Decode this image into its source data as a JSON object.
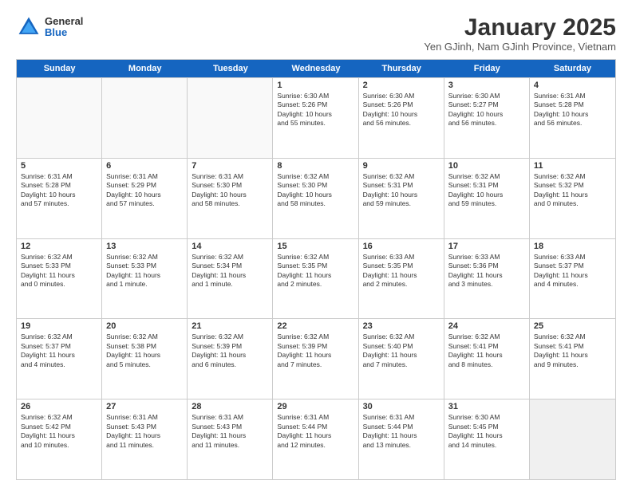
{
  "logo": {
    "general": "General",
    "blue": "Blue"
  },
  "title": "January 2025",
  "subtitle": "Yen GJinh, Nam GJinh Province, Vietnam",
  "days": [
    "Sunday",
    "Monday",
    "Tuesday",
    "Wednesday",
    "Thursday",
    "Friday",
    "Saturday"
  ],
  "rows": [
    [
      {
        "day": "",
        "lines": []
      },
      {
        "day": "",
        "lines": []
      },
      {
        "day": "",
        "lines": []
      },
      {
        "day": "1",
        "lines": [
          "Sunrise: 6:30 AM",
          "Sunset: 5:26 PM",
          "Daylight: 10 hours",
          "and 55 minutes."
        ]
      },
      {
        "day": "2",
        "lines": [
          "Sunrise: 6:30 AM",
          "Sunset: 5:26 PM",
          "Daylight: 10 hours",
          "and 56 minutes."
        ]
      },
      {
        "day": "3",
        "lines": [
          "Sunrise: 6:30 AM",
          "Sunset: 5:27 PM",
          "Daylight: 10 hours",
          "and 56 minutes."
        ]
      },
      {
        "day": "4",
        "lines": [
          "Sunrise: 6:31 AM",
          "Sunset: 5:28 PM",
          "Daylight: 10 hours",
          "and 56 minutes."
        ]
      }
    ],
    [
      {
        "day": "5",
        "lines": [
          "Sunrise: 6:31 AM",
          "Sunset: 5:28 PM",
          "Daylight: 10 hours",
          "and 57 minutes."
        ]
      },
      {
        "day": "6",
        "lines": [
          "Sunrise: 6:31 AM",
          "Sunset: 5:29 PM",
          "Daylight: 10 hours",
          "and 57 minutes."
        ]
      },
      {
        "day": "7",
        "lines": [
          "Sunrise: 6:31 AM",
          "Sunset: 5:30 PM",
          "Daylight: 10 hours",
          "and 58 minutes."
        ]
      },
      {
        "day": "8",
        "lines": [
          "Sunrise: 6:32 AM",
          "Sunset: 5:30 PM",
          "Daylight: 10 hours",
          "and 58 minutes."
        ]
      },
      {
        "day": "9",
        "lines": [
          "Sunrise: 6:32 AM",
          "Sunset: 5:31 PM",
          "Daylight: 10 hours",
          "and 59 minutes."
        ]
      },
      {
        "day": "10",
        "lines": [
          "Sunrise: 6:32 AM",
          "Sunset: 5:31 PM",
          "Daylight: 10 hours",
          "and 59 minutes."
        ]
      },
      {
        "day": "11",
        "lines": [
          "Sunrise: 6:32 AM",
          "Sunset: 5:32 PM",
          "Daylight: 11 hours",
          "and 0 minutes."
        ]
      }
    ],
    [
      {
        "day": "12",
        "lines": [
          "Sunrise: 6:32 AM",
          "Sunset: 5:33 PM",
          "Daylight: 11 hours",
          "and 0 minutes."
        ]
      },
      {
        "day": "13",
        "lines": [
          "Sunrise: 6:32 AM",
          "Sunset: 5:33 PM",
          "Daylight: 11 hours",
          "and 1 minute."
        ]
      },
      {
        "day": "14",
        "lines": [
          "Sunrise: 6:32 AM",
          "Sunset: 5:34 PM",
          "Daylight: 11 hours",
          "and 1 minute."
        ]
      },
      {
        "day": "15",
        "lines": [
          "Sunrise: 6:32 AM",
          "Sunset: 5:35 PM",
          "Daylight: 11 hours",
          "and 2 minutes."
        ]
      },
      {
        "day": "16",
        "lines": [
          "Sunrise: 6:33 AM",
          "Sunset: 5:35 PM",
          "Daylight: 11 hours",
          "and 2 minutes."
        ]
      },
      {
        "day": "17",
        "lines": [
          "Sunrise: 6:33 AM",
          "Sunset: 5:36 PM",
          "Daylight: 11 hours",
          "and 3 minutes."
        ]
      },
      {
        "day": "18",
        "lines": [
          "Sunrise: 6:33 AM",
          "Sunset: 5:37 PM",
          "Daylight: 11 hours",
          "and 4 minutes."
        ]
      }
    ],
    [
      {
        "day": "19",
        "lines": [
          "Sunrise: 6:32 AM",
          "Sunset: 5:37 PM",
          "Daylight: 11 hours",
          "and 4 minutes."
        ]
      },
      {
        "day": "20",
        "lines": [
          "Sunrise: 6:32 AM",
          "Sunset: 5:38 PM",
          "Daylight: 11 hours",
          "and 5 minutes."
        ]
      },
      {
        "day": "21",
        "lines": [
          "Sunrise: 6:32 AM",
          "Sunset: 5:39 PM",
          "Daylight: 11 hours",
          "and 6 minutes."
        ]
      },
      {
        "day": "22",
        "lines": [
          "Sunrise: 6:32 AM",
          "Sunset: 5:39 PM",
          "Daylight: 11 hours",
          "and 7 minutes."
        ]
      },
      {
        "day": "23",
        "lines": [
          "Sunrise: 6:32 AM",
          "Sunset: 5:40 PM",
          "Daylight: 11 hours",
          "and 7 minutes."
        ]
      },
      {
        "day": "24",
        "lines": [
          "Sunrise: 6:32 AM",
          "Sunset: 5:41 PM",
          "Daylight: 11 hours",
          "and 8 minutes."
        ]
      },
      {
        "day": "25",
        "lines": [
          "Sunrise: 6:32 AM",
          "Sunset: 5:41 PM",
          "Daylight: 11 hours",
          "and 9 minutes."
        ]
      }
    ],
    [
      {
        "day": "26",
        "lines": [
          "Sunrise: 6:32 AM",
          "Sunset: 5:42 PM",
          "Daylight: 11 hours",
          "and 10 minutes."
        ]
      },
      {
        "day": "27",
        "lines": [
          "Sunrise: 6:31 AM",
          "Sunset: 5:43 PM",
          "Daylight: 11 hours",
          "and 11 minutes."
        ]
      },
      {
        "day": "28",
        "lines": [
          "Sunrise: 6:31 AM",
          "Sunset: 5:43 PM",
          "Daylight: 11 hours",
          "and 11 minutes."
        ]
      },
      {
        "day": "29",
        "lines": [
          "Sunrise: 6:31 AM",
          "Sunset: 5:44 PM",
          "Daylight: 11 hours",
          "and 12 minutes."
        ]
      },
      {
        "day": "30",
        "lines": [
          "Sunrise: 6:31 AM",
          "Sunset: 5:44 PM",
          "Daylight: 11 hours",
          "and 13 minutes."
        ]
      },
      {
        "day": "31",
        "lines": [
          "Sunrise: 6:30 AM",
          "Sunset: 5:45 PM",
          "Daylight: 11 hours",
          "and 14 minutes."
        ]
      },
      {
        "day": "",
        "lines": []
      }
    ]
  ]
}
